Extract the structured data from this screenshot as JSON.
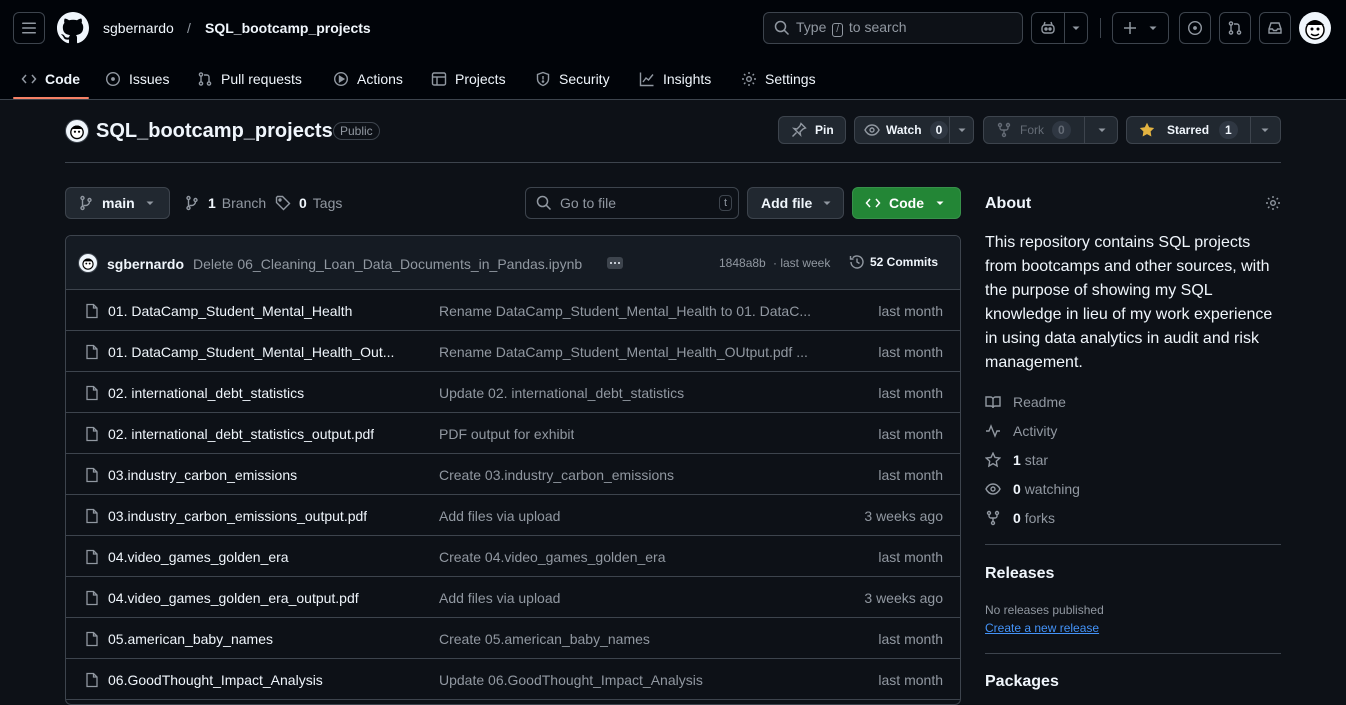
{
  "header": {
    "owner": "sgbernardo",
    "separator": "/",
    "repo": "SQL_bootcamp_projects",
    "search": {
      "prefix": "Type",
      "key": "/",
      "suffix": "to search"
    }
  },
  "tabs": [
    {
      "label": "Code",
      "icon": "code-icon"
    },
    {
      "label": "Issues",
      "icon": "issue-icon"
    },
    {
      "label": "Pull requests",
      "icon": "pull-request-icon"
    },
    {
      "label": "Actions",
      "icon": "play-icon"
    },
    {
      "label": "Projects",
      "icon": "table-icon"
    },
    {
      "label": "Security",
      "icon": "shield-icon"
    },
    {
      "label": "Insights",
      "icon": "graph-icon"
    },
    {
      "label": "Settings",
      "icon": "gear-icon"
    }
  ],
  "repo": {
    "title": "SQL_bootcamp_projects",
    "visibility": "Public",
    "pin": "Pin",
    "watch": "Watch",
    "watch_count": "0",
    "fork": "Fork",
    "fork_count": "0",
    "starred": "Starred",
    "star_count": "1"
  },
  "toolbar": {
    "branch": "main",
    "branches_count": "1",
    "branches_label": "Branch",
    "tags_count": "0",
    "tags_label": "Tags",
    "go_to_file": "Go to file",
    "go_to_file_key": "t",
    "add_file": "Add file",
    "code": "Code"
  },
  "commit": {
    "author": "sgbernardo",
    "message": "Delete 06_Cleaning_Loan_Data_Documents_in_Pandas.ipynb",
    "sha": "1848a8b",
    "time": "· last week",
    "commits": "52 Commits"
  },
  "files": [
    {
      "name": "01. DataCamp_Student_Mental_Health",
      "message": "Rename DataCamp_Student_Mental_Health to 01. DataC...",
      "date": "last month"
    },
    {
      "name": "01. DataCamp_Student_Mental_Health_Out...",
      "message": "Rename DataCamp_Student_Mental_Health_OUtput.pdf ...",
      "date": "last month"
    },
    {
      "name": "02. international_debt_statistics",
      "message": "Update 02. international_debt_statistics",
      "date": "last month"
    },
    {
      "name": "02. international_debt_statistics_output.pdf",
      "message": "PDF output for exhibit",
      "date": "last month"
    },
    {
      "name": "03.industry_carbon_emissions",
      "message": "Create 03.industry_carbon_emissions",
      "date": "last month"
    },
    {
      "name": "03.industry_carbon_emissions_output.pdf",
      "message": "Add files via upload",
      "date": "3 weeks ago"
    },
    {
      "name": "04.video_games_golden_era",
      "message": "Create 04.video_games_golden_era",
      "date": "last month"
    },
    {
      "name": "04.video_games_golden_era_output.pdf",
      "message": "Add files via upload",
      "date": "3 weeks ago"
    },
    {
      "name": "05.american_baby_names",
      "message": "Create 05.american_baby_names",
      "date": "last month"
    },
    {
      "name": "06.GoodThought_Impact_Analysis",
      "message": "Update 06.GoodThought_Impact_Analysis",
      "date": "last month"
    }
  ],
  "about": {
    "title": "About",
    "description": "This repository contains SQL projects from bootcamps and other sources, with the purpose of showing my SQL knowledge in lieu of my work experience in using data analytics in audit and risk management.",
    "readme": "Readme",
    "activity": "Activity",
    "stars_count": "1",
    "stars_label": "star",
    "watching_count": "0",
    "watching_label": "watching",
    "forks_count": "0",
    "forks_label": "forks"
  },
  "releases": {
    "title": "Releases",
    "none": "No releases published",
    "create": "Create a new release"
  },
  "packages": {
    "title": "Packages"
  },
  "colors": {
    "accent_green": "#238636",
    "tab_underline": "#f78166",
    "link": "#4493f8",
    "star": "#e3b341"
  }
}
